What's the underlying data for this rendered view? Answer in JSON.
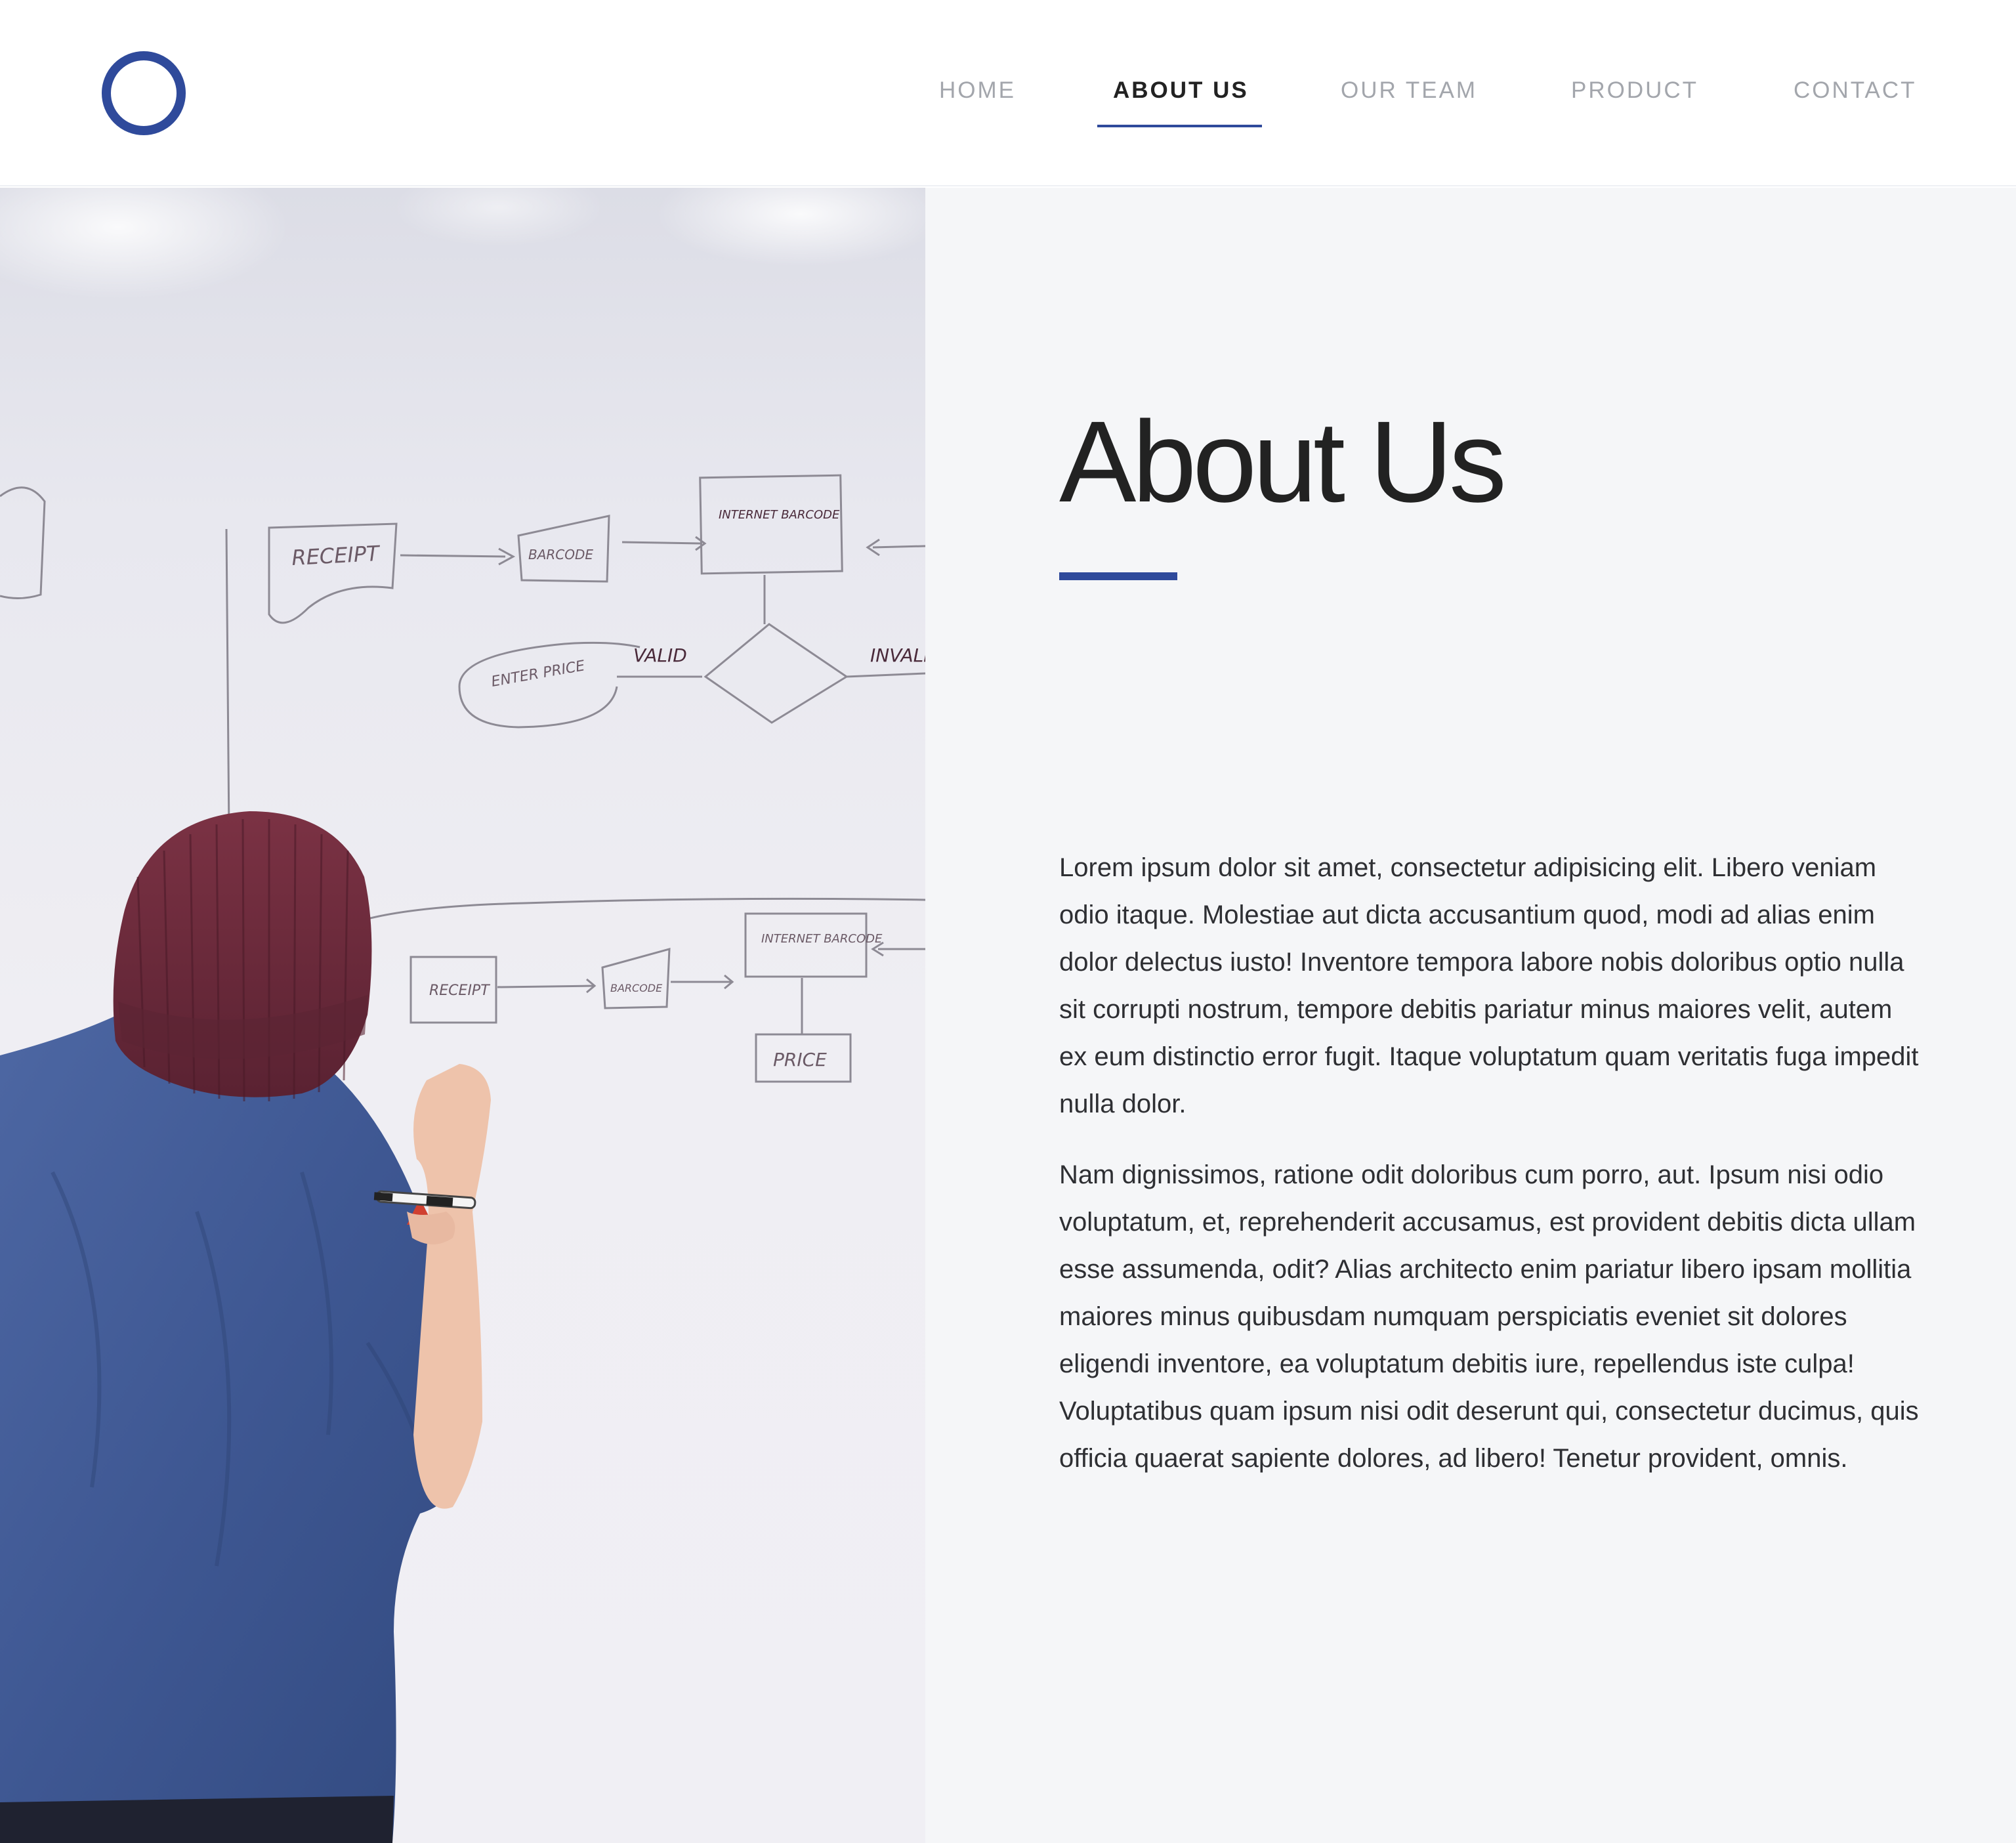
{
  "brand": {
    "logo_icon": "ring-logo",
    "accent_color": "#2f4a9b"
  },
  "nav": {
    "items": [
      {
        "label": "HOME",
        "active": false
      },
      {
        "label": "ABOUT US",
        "active": true
      },
      {
        "label": "OUR TEAM",
        "active": false
      },
      {
        "label": "PRODUCT",
        "active": false
      },
      {
        "label": "CONTACT",
        "active": false
      }
    ]
  },
  "hero": {
    "image": "person-at-whiteboard-photo",
    "whiteboard_words": [
      "RECEIPT",
      "BARCODE",
      "INTERNET BARCODE",
      "ENTER PRICE",
      "VALID",
      "INVALID ?",
      "PRICE"
    ]
  },
  "about": {
    "title": "About Us",
    "paragraphs": [
      "Lorem ipsum dolor sit amet, consectetur adipisicing elit. Libero veniam odio itaque. Molestiae aut dicta accusantium quod, modi ad alias enim dolor delectus iusto! Inventore tempora labore nobis doloribus optio nulla sit corrupti nostrum, tempore debitis pariatur minus maiores velit, autem ex eum distinctio error fugit. Itaque voluptatum quam veritatis fuga impedit nulla dolor.",
      "Nam dignissimos, ratione odit doloribus cum porro, aut. Ipsum nisi odio voluptatum, et, reprehenderit accusamus, est provident debitis dicta ullam esse assumenda, odit? Alias architecto enim pariatur libero ipsam mollitia maiores minus quibusdam numquam perspiciatis eveniet sit dolores eligendi inventore, ea voluptatum debitis iure, repellendus iste culpa! Voluptatibus quam ipsum nisi odit deserunt qui, consectetur ducimus, quis officia quaerat sapiente dolores, ad libero! Tenetur provident, omnis."
    ]
  }
}
